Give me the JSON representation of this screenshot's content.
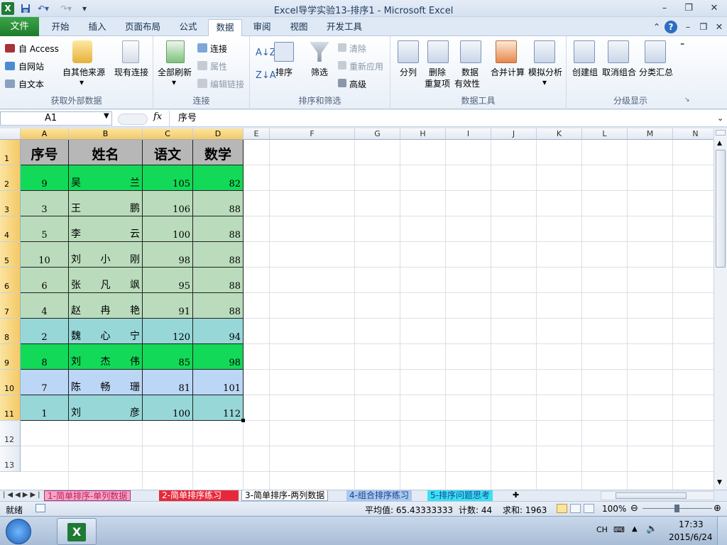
{
  "window": {
    "title": "Excel导学实验13-排序1  -  Microsoft Excel",
    "controls": [
      "–",
      "❐",
      "✕"
    ]
  },
  "ribbon_tabs": {
    "file": "文件",
    "items": [
      "开始",
      "插入",
      "页面布局",
      "公式",
      "数据",
      "审阅",
      "视图",
      "开发工具"
    ],
    "active": "数据"
  },
  "ribbon": {
    "get_external": {
      "label": "获取外部数据",
      "from_access": "自 Access",
      "from_web": "自网站",
      "from_text": "自文本",
      "from_other": "自其他来源",
      "existing": "现有连接"
    },
    "connections": {
      "label": "连接",
      "refresh_all": "全部刷新",
      "connections": "连接",
      "properties": "属性",
      "edit_links": "编辑链接"
    },
    "sort_filter": {
      "label": "排序和筛选",
      "sort": "排序",
      "filter": "筛选",
      "clear": "清除",
      "reapply": "重新应用",
      "advanced": "高级"
    },
    "data_tools": {
      "label": "数据工具",
      "text_to_cols": "分列",
      "remove_dup_1": "删除",
      "remove_dup_2": "重复项",
      "validation_1": "数据",
      "validation_2": "有效性",
      "consolidate": "合并计算",
      "whatif": "模拟分析"
    },
    "outline": {
      "label": "分级显示",
      "group": "创建组",
      "ungroup": "取消组合",
      "subtotal": "分类汇总"
    }
  },
  "formula_bar": {
    "name_box": "A1",
    "fx": "fx",
    "content": "序号"
  },
  "columns": [
    "A",
    "B",
    "C",
    "D",
    "E",
    "F",
    "G",
    "H",
    "I",
    "J",
    "K",
    "L",
    "M",
    "N"
  ],
  "rows": [
    "1",
    "2",
    "3",
    "4",
    "5",
    "6",
    "7",
    "8",
    "9",
    "10",
    "11",
    "12",
    "13"
  ],
  "table": {
    "headers": [
      "序号",
      "姓名",
      "语文",
      "数学"
    ],
    "rows": [
      {
        "no": "9",
        "name": [
          "吴",
          "兰"
        ],
        "chinese": "105",
        "math": "82",
        "color": "#12d957"
      },
      {
        "no": "3",
        "name": [
          "王",
          "鹏"
        ],
        "chinese": "106",
        "math": "88",
        "color": "#badcbc"
      },
      {
        "no": "5",
        "name": [
          "李",
          "云"
        ],
        "chinese": "100",
        "math": "88",
        "color": "#badcbc"
      },
      {
        "no": "10",
        "name": [
          "刘",
          "小",
          "刚"
        ],
        "chinese": "98",
        "math": "88",
        "color": "#badcbc"
      },
      {
        "no": "6",
        "name": [
          "张",
          "凡",
          "飒"
        ],
        "chinese": "95",
        "math": "88",
        "color": "#badcbc"
      },
      {
        "no": "4",
        "name": [
          "赵",
          "冉",
          "艳"
        ],
        "chinese": "91",
        "math": "88",
        "color": "#badcbc"
      },
      {
        "no": "2",
        "name": [
          "魏",
          "心",
          "宁"
        ],
        "chinese": "120",
        "math": "94",
        "color": "#97d7d8"
      },
      {
        "no": "8",
        "name": [
          "刘",
          "杰",
          "伟"
        ],
        "chinese": "85",
        "math": "98",
        "color": "#12d957"
      },
      {
        "no": "7",
        "name": [
          "陈",
          "畅",
          "珊"
        ],
        "chinese": "81",
        "math": "101",
        "color": "#bcd6f5"
      },
      {
        "no": "1",
        "name": [
          "刘",
          "彦"
        ],
        "chinese": "100",
        "math": "112",
        "color": "#97d7d8"
      }
    ],
    "header_color": "#b7b7b7"
  },
  "sheet_tabs": [
    {
      "label": "1-简单排序-单列数据",
      "color": "#f4a6c4"
    },
    {
      "label": "2-简单排序练习",
      "color": "#e8283a"
    },
    {
      "label": "3-简单排序-两列数据",
      "color": "#ffffff"
    },
    {
      "label": "4-组合排序练习",
      "color": "#a9c9f1"
    },
    {
      "label": "5-排序问题思考",
      "color": "#39e2f0"
    }
  ],
  "status": {
    "mode": "就绪",
    "average": "平均值: 65.43333333",
    "count": "计数: 44",
    "sum": "求和: 1963",
    "zoom": "100%"
  },
  "taskbar": {
    "lang": "CH",
    "time": "17:33",
    "date": "2015/6/24"
  }
}
